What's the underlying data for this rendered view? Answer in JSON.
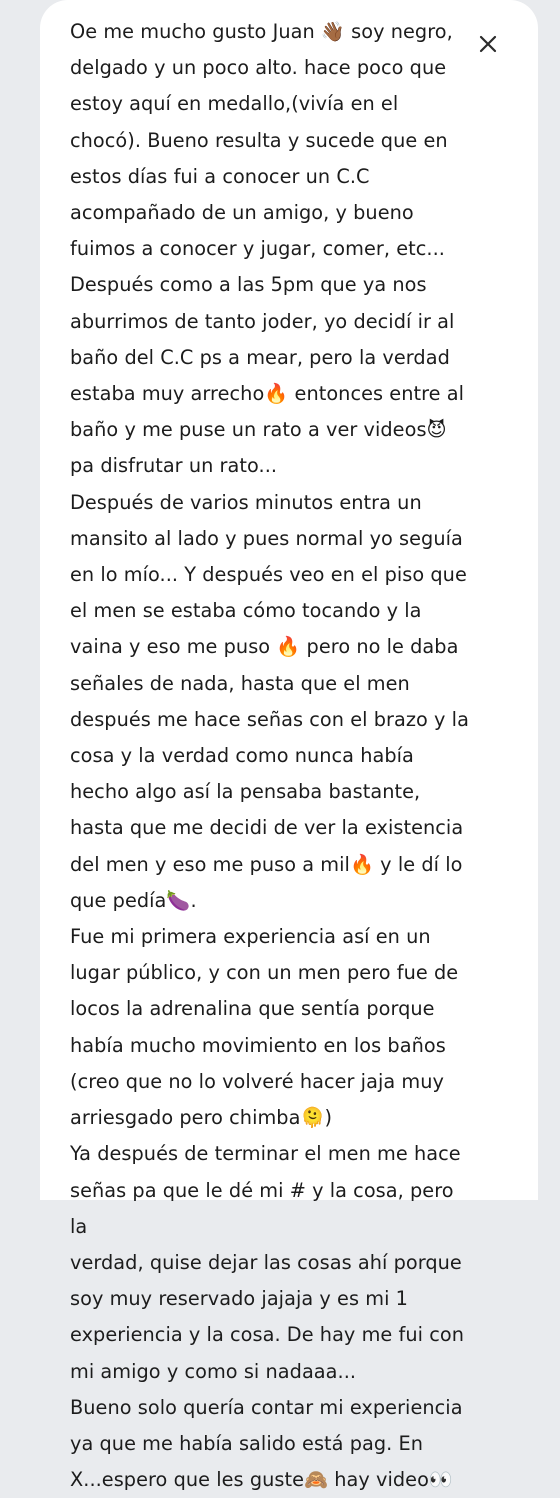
{
  "dialog": {
    "close_icon": "close-icon",
    "message": "Oe me mucho gusto Juan 👋🏾 soy negro,\ndelgado y un poco alto. hace poco que\nestoy aquí en medallo,(vivía en el\nchocó). Bueno resulta y sucede que en\nestos días fui a conocer un C.C\nacompañado de un amigo, y bueno\nfuimos a conocer y jugar, comer, etc...\nDespués como a las 5pm que ya nos\naburrimos de tanto joder, yo decidí ir al\nbaño del C.C ps a mear, pero la verdad\nestaba muy arrecho🔥 entonces entre al\nbaño y me puse un rato a ver videos😈\npa disfrutar un rato...\nDespués de varios minutos entra un\nmansito al lado y pues normal yo seguía\nen lo mío... Y después veo en el piso que\nel men se estaba cómo tocando y la\nvaina y eso me puso 🔥 pero no le daba\nseñales de nada, hasta que el men\ndespués me hace señas con el brazo y la\ncosa y la verdad como nunca había\nhecho algo así la pensaba bastante,\nhasta que me decidi de ver la existencia\ndel men y eso me puso a mil🔥 y le dí lo\nque pedía🍆.\nFue mi primera experiencia así en un\nlugar público, y con un men pero fue de\nlocos la adrenalina que sentía porque\nhabía mucho movimiento en los baños\n(creo que no lo volveré hacer jaja muy\narriesgado pero chimba🫠)\nYa después de terminar el men me hace\nseñas pa que le dé mi # y la cosa, pero la\nverdad, quise dejar las cosas ahí porque\nsoy muy reservado jajaja y es mi 1\nexperiencia y la cosa. De hay me fui con\nmi amigo y como si nadaaa...\nBueno solo quería contar mi experiencia\nya que me había salido está pag. En\nX...espero que les guste🙈 hay video👀"
  }
}
